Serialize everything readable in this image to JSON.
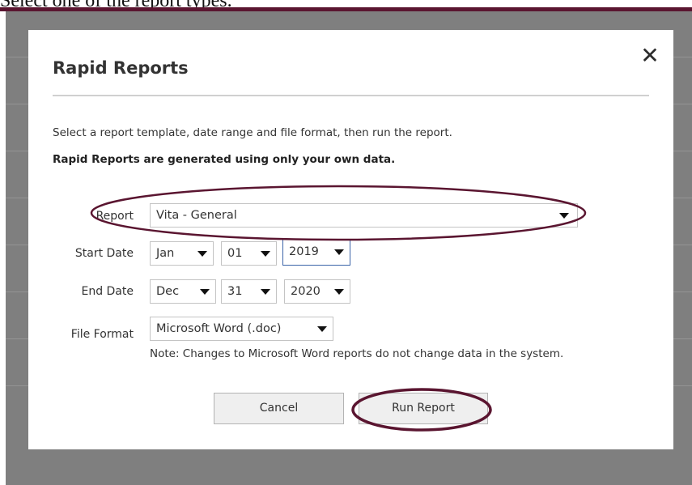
{
  "page": {
    "caption": "Select one of the report types."
  },
  "dialog": {
    "title": "Rapid Reports",
    "close_glyph": "✕",
    "intro": "Select a report template, date range and file format, then run the report.",
    "intro_bold": "Rapid Reports are generated using only your own data.",
    "report": {
      "label": "Report",
      "value": "Vita - General"
    },
    "start_date": {
      "label": "Start Date",
      "month": "Jan",
      "day": "01",
      "year": "2019"
    },
    "end_date": {
      "label": "End Date",
      "month": "Dec",
      "day": "31",
      "year": "2020"
    },
    "file_format": {
      "label": "File Format",
      "value": "Microsoft Word (.doc)"
    },
    "note": "Note: Changes to Microsoft Word reports do not change data in the system.",
    "cancel_label": "Cancel",
    "run_label": "Run Report"
  },
  "colors": {
    "annotation": "#5a1530",
    "overlay": "#7f7f7f",
    "focus_border": "#3a63a8"
  },
  "icons": {
    "close": "close-icon",
    "dropdown": "chevron-down-icon"
  }
}
